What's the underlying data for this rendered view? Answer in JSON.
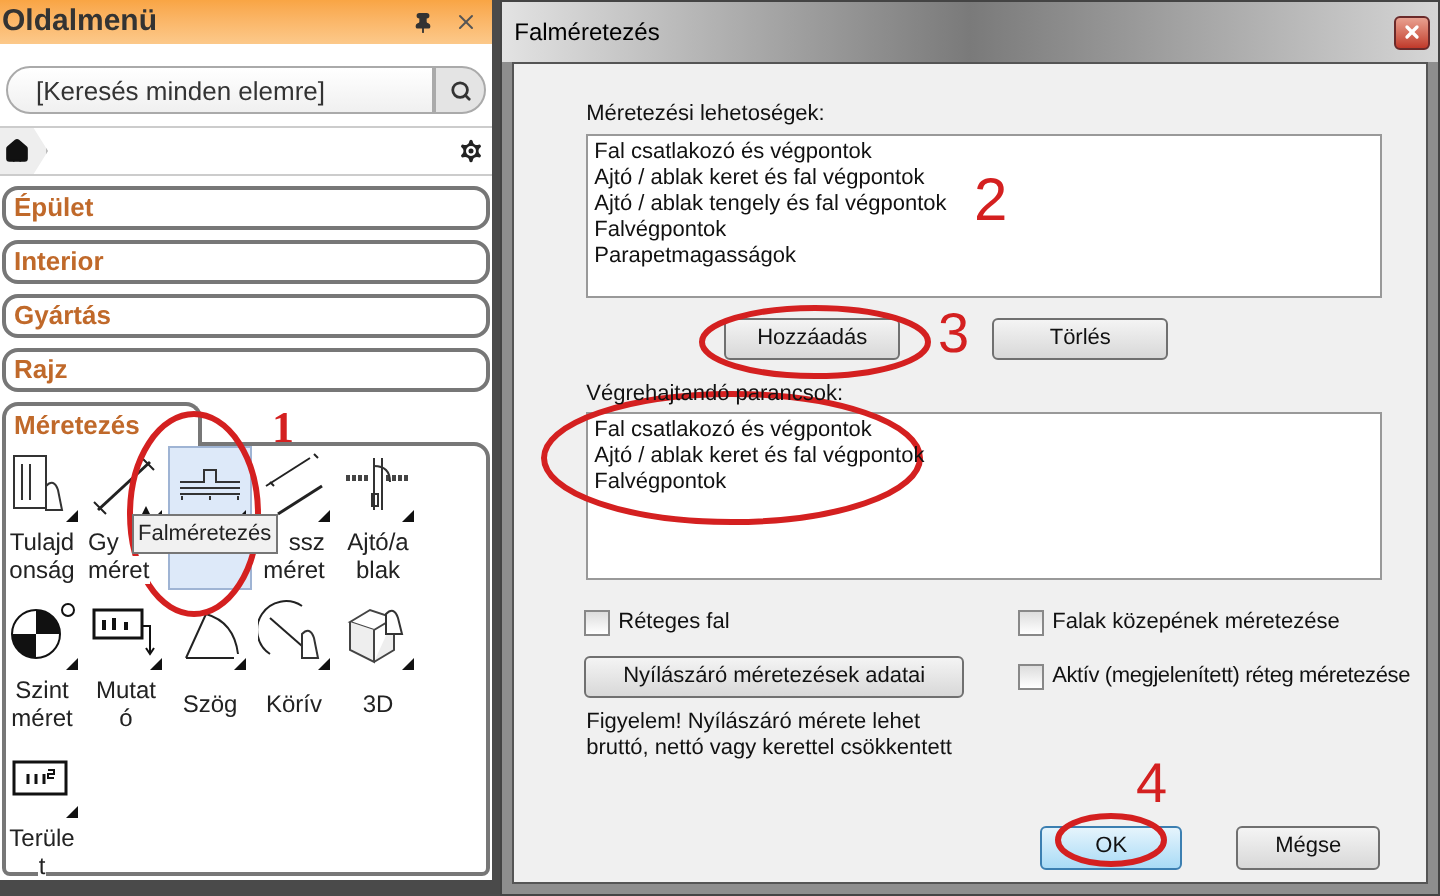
{
  "sidebar": {
    "title": "Oldalmenü",
    "search": {
      "placeholder": "[Keresés minden elemre]"
    },
    "categories": [
      {
        "label": "Épület",
        "expanded": false
      },
      {
        "label": "Interior",
        "expanded": false
      },
      {
        "label": "Gyártás",
        "expanded": false
      },
      {
        "label": "Rajz",
        "expanded": false
      },
      {
        "label": "Méretezés",
        "expanded": true
      }
    ],
    "tools": [
      {
        "kind": "properties",
        "lines": [
          "Tulajd",
          "onság"
        ],
        "selected": false
      },
      {
        "kind": "diagonal",
        "lines": [
          "Gy",
          "méret"
        ],
        "selected": false
      },
      {
        "kind": "wall",
        "selected": true
      },
      {
        "kind": "aligned",
        "lines": [
          "ssz",
          "méret"
        ],
        "selected": false
      },
      {
        "kind": "door",
        "lines": [
          "Ajtó/a",
          "blak"
        ],
        "selected": false
      },
      {
        "kind": "level",
        "lines": [
          "Szint",
          "méret"
        ],
        "selected": false
      },
      {
        "kind": "label",
        "lines": [
          "Mutat",
          "ó"
        ],
        "selected": false
      },
      {
        "kind": "angle",
        "lines": [
          "Szög"
        ],
        "selected": false
      },
      {
        "kind": "arc",
        "lines": [
          "Körív"
        ],
        "selected": false
      },
      {
        "kind": "cube",
        "lines": [
          "3D"
        ],
        "selected": false
      },
      {
        "kind": "area",
        "lines": [
          "Terüle",
          "t"
        ],
        "selected": false
      }
    ],
    "tooltip": "Falméretezés"
  },
  "dialog": {
    "title": "Falméretezés",
    "options_label": "Méretezési lehetoségek:",
    "options": [
      "Fal csatlakozó és végpontok",
      "Ajtó / ablak keret és fal végpontok",
      "Ajtó / ablak tengely és fal végpontok",
      "Falvégpontok",
      "Parapetmagasságok"
    ],
    "list_buttons": [
      "Hozzáadás",
      "Törlés"
    ],
    "commands_label": "Végrehajtandó parancsok:",
    "commands": [
      "Fal csatlakozó és végpontok",
      "Ajtó / ablak keret és fal végpontok",
      "Falvégpontok"
    ],
    "checkboxes": [
      {
        "label": "Réteges fal",
        "checked": false
      },
      {
        "label": "Falak közepének méretezése",
        "checked": false
      },
      {
        "label": "Aktív (megjelenített) réteg méretezése",
        "checked": false
      }
    ],
    "opening_button": "Nyílászáró méretezések adatai",
    "note": "Figyelem! Nyílászáró mérete lehet bruttó, nettó vagy kerettel csökkentett",
    "buttons": [
      {
        "label": "OK",
        "default": true
      },
      {
        "label": "Mégse",
        "default": false
      }
    ]
  },
  "annotations": [
    {
      "label": "1"
    },
    {
      "label": "2"
    },
    {
      "label": "3"
    },
    {
      "label": "4"
    }
  ]
}
